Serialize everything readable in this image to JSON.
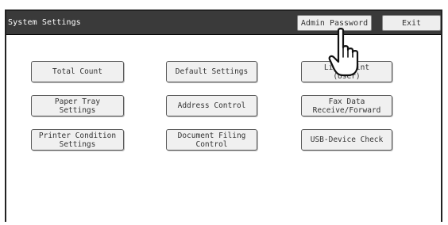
{
  "window": {
    "title": "System Settings",
    "admin_password_label": "Admin Password",
    "exit_label": "Exit"
  },
  "menu": {
    "total_count": "Total Count",
    "default_settings": "Default Settings",
    "list_print": "List Print\n(User)",
    "paper_tray_settings": "Paper Tray\nSettings",
    "address_control": "Address Control",
    "fax_data_receive_forward": "Fax Data\nReceive/Forward",
    "printer_condition_settings": "Printer Condition\nSettings",
    "document_filing_control": "Document Filing\nControl",
    "usb_device_check": "USB-Device Check"
  },
  "icons": {
    "pointer": "pointing-hand-icon"
  }
}
